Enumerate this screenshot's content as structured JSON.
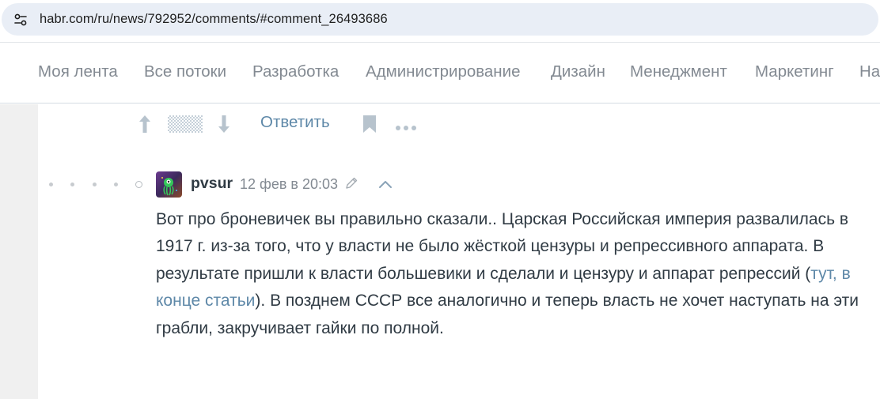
{
  "browser": {
    "url": "habr.com/ru/news/792952/comments/#comment_26493686"
  },
  "nav": {
    "items": [
      "Моя лента",
      "Все потоки",
      "Разработка",
      "Администрирование",
      "Дизайн",
      "Менеджмент",
      "Маркетинг",
      "На"
    ]
  },
  "prev_comment_actions": {
    "reply_label": "Ответить"
  },
  "comment": {
    "author": "pvsur",
    "date": "12 фев в 20:03",
    "text_before_link": "Вот про броневичек вы правильно сказали.. Царская Российская империя развалилась в 1917 г. из-за того, что у власти не было жёсткой цензуры и репрессивного аппарата. В результате пришли к власти большевики и сделали и цензуру и аппарат репрессий (",
    "link_text": "тут, в конце статьи",
    "text_after_link": "). В позднем СССР все аналогично и теперь власть не хочет наступать на эти грабли, закручивает гайки по полной."
  },
  "colors": {
    "link": "#5e88a8",
    "nav_text": "#838a92",
    "body_text": "#303b44",
    "address_bg": "#e9eef6"
  }
}
